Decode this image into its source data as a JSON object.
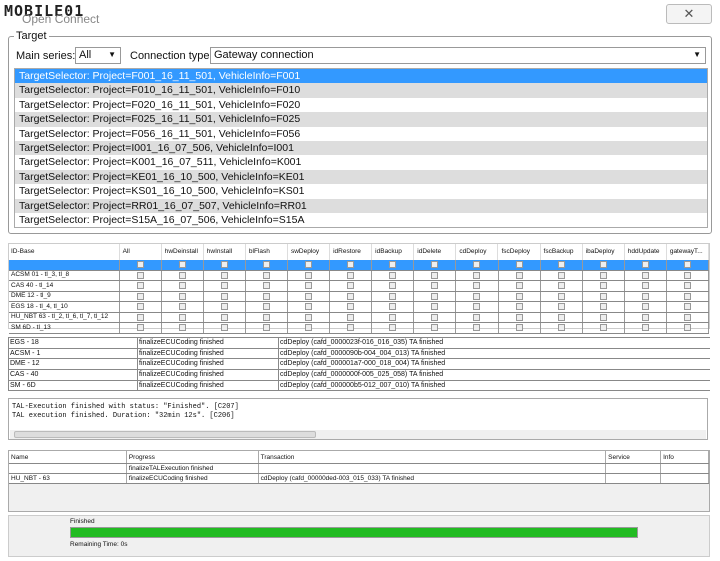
{
  "window": {
    "watermark": "MOBILE01",
    "title": "Open Connect",
    "close": "✕"
  },
  "target": {
    "group_label": "Target",
    "main_series_label": "Main series:",
    "main_series_value": "All",
    "connection_type_label": "Connection type:",
    "connection_type_value": "Gateway connection",
    "selectors": [
      "TargetSelector: Project=F001_16_11_501, VehicleInfo=F001",
      "TargetSelector: Project=F010_16_11_501, VehicleInfo=F010",
      "TargetSelector: Project=F020_16_11_501, VehicleInfo=F020",
      "TargetSelector: Project=F025_16_11_501, VehicleInfo=F025",
      "TargetSelector: Project=F056_16_11_501, VehicleInfo=F056",
      "TargetSelector: Project=I001_16_07_506, VehicleInfo=I001",
      "TargetSelector: Project=K001_16_07_511, VehicleInfo=K001",
      "TargetSelector: Project=KE01_16_10_500, VehicleInfo=KE01",
      "TargetSelector: Project=KS01_16_10_500, VehicleInfo=KS01",
      "TargetSelector: Project=RR01_16_07_507, VehicleInfo=RR01",
      "TargetSelector: Project=S15A_16_07_506, VehicleInfo=S15A"
    ]
  },
  "grid": {
    "headers": [
      "ID-Base",
      "All",
      "hwDeinstall",
      "hwInstall",
      "blFlash",
      "swDeploy",
      "idRestore",
      "idBackup",
      "idDelete",
      "cdDeploy",
      "fscDeploy",
      "fscBackup",
      "ibaDeploy",
      "hddUpdate",
      "gatewayT..."
    ],
    "rows": [
      "ACSM 01 - tl_3, tl_8",
      "CAS 40 - tl_14",
      "DME 12 - tl_9",
      "EGS 18 - tl_4, tl_10",
      "HU_NBT 63 - tl_2, tl_6, tl_7, tl_12",
      "SM 6D - tl_13"
    ]
  },
  "status": [
    [
      "EGS - 18",
      "finalizeECUCoding finished",
      "cdDeploy (cafd_0000023f-016_016_035) TA finished"
    ],
    [
      "ACSM - 1",
      "finalizeECUCoding finished",
      "cdDeploy (cafd_0000090b-004_004_013) TA finished"
    ],
    [
      "DME - 12",
      "finalizeECUCoding finished",
      "cdDeploy (cafd_000001a7-000_018_004) TA finished"
    ],
    [
      "CAS - 40",
      "finalizeECUCoding finished",
      "cdDeploy (cafd_0000000f-005_025_058) TA finished"
    ],
    [
      "SM - 6D",
      "finalizeECUCoding finished",
      "cdDeploy (cafd_000000b5-012_007_010) TA finished"
    ]
  ],
  "log": [
    "TAL-Execution finished with status: \"Finished\". [C207]",
    "TAL execution finished. Duration: \"32min 12s\". [C206]"
  ],
  "bottom": {
    "headers": [
      "Name",
      "Progress",
      "Transaction",
      "Service",
      "Info"
    ],
    "rows": [
      [
        "",
        "finalizeTALExecution finished",
        "",
        "",
        ""
      ],
      [
        "HU_NBT - 63",
        "finalizeECUCoding finished",
        "cdDeploy (cafd_00000ded-003_015_033) TA finished",
        "",
        ""
      ]
    ]
  },
  "progress": {
    "status": "Finished",
    "percent": 100,
    "remaining": "Remaining Time: 0s",
    "color": "#22bb22"
  }
}
